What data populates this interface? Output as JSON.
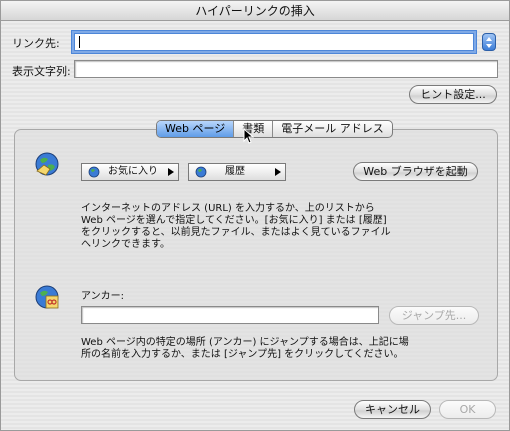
{
  "window": {
    "title": "ハイパーリンクの挿入"
  },
  "form": {
    "link_label": "リンク先:",
    "link_value": "",
    "display_label": "表示文字列:",
    "display_value": "",
    "hint_button": "ヒント設定..."
  },
  "tabs": [
    {
      "label": "Web ページ",
      "active": true
    },
    {
      "label": "書類",
      "active": false
    },
    {
      "label": "電子メール アドレス",
      "active": false
    }
  ],
  "web_panel": {
    "favorites_button": "お気に入り",
    "history_button": "履歴",
    "browser_button": "Web ブラウザを起動",
    "instructions": "インターネットのアドレス (URL) を入力するか、上のリストから Web ページを選んで指定してください。[お気に入り] または [履歴] をクリックすると、以前見たファイル、またはよく見ているファイルへリンクできます。",
    "anchor_label": "アンカー:",
    "anchor_value": "",
    "jump_button": "ジャンプ先...",
    "anchor_instructions": "Web ページ内の特定の場所 (アンカー) にジャンプする場合は、上記に場所の名前を入力するか、または [ジャンプ先] をクリックしてください。"
  },
  "footer": {
    "cancel_button": "キャンセル",
    "ok_button": "OK"
  },
  "icons": {
    "globe": "globe-icon",
    "anchor": "anchor-globe-icon",
    "arrow": "triangle-right-icon",
    "stepper": "stepper-arrows-icon",
    "cursor": "mouse-pointer-icon"
  },
  "colors": {
    "accent": "#4d86d8",
    "active_tab": "#5f9ce8"
  }
}
